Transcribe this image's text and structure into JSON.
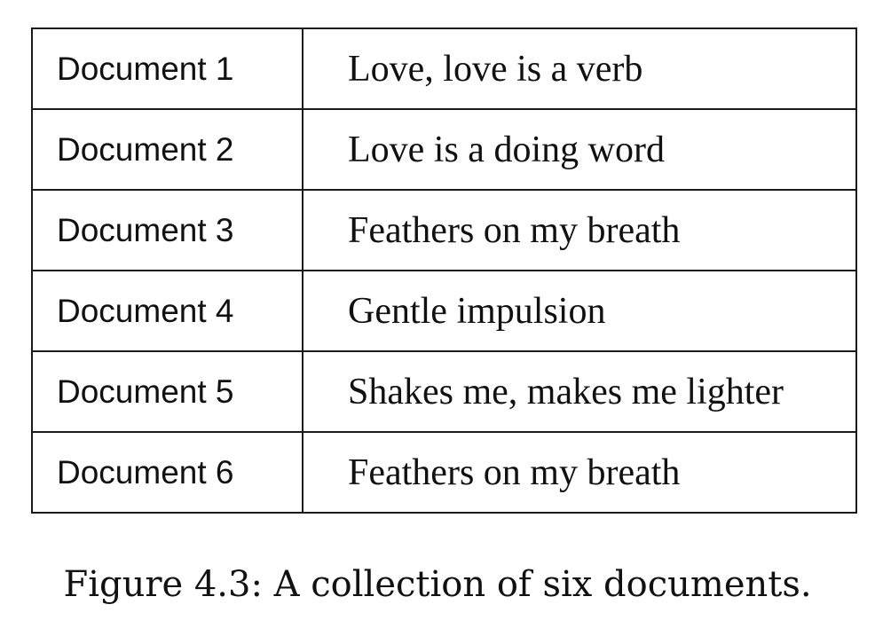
{
  "table": {
    "rows": [
      {
        "name": "Document 1",
        "text": "Love, love is a verb"
      },
      {
        "name": "Document 2",
        "text": "Love is a doing word"
      },
      {
        "name": "Document 3",
        "text": "Feathers on my breath"
      },
      {
        "name": "Document 4",
        "text": "Gentle impulsion"
      },
      {
        "name": "Document 5",
        "text": "Shakes me, makes me lighter"
      },
      {
        "name": "Document 6",
        "text": "Feathers on my breath"
      }
    ]
  },
  "caption": "Figure 4.3: A collection of six documents."
}
